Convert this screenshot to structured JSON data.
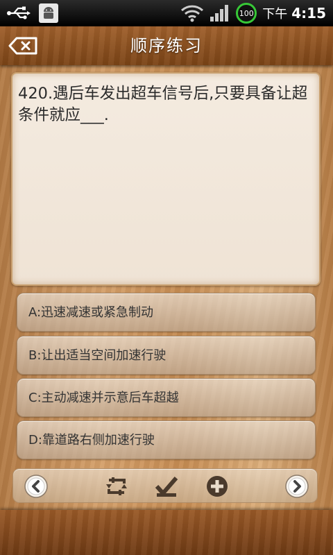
{
  "status_bar": {
    "battery_level": "100",
    "time_prefix": "下午",
    "time": "4:15"
  },
  "header": {
    "title": "顺序练习",
    "back_icon": "backspace-icon"
  },
  "question": {
    "text": "420.遇后车发出超车信号后,只要具备让超条件就应___."
  },
  "options": [
    {
      "label": "A:迅速减速或紧急制动"
    },
    {
      "label": "B:让出适当空间加速行驶"
    },
    {
      "label": "C:主动减速并示意后车超越"
    },
    {
      "label": "D:靠道路右侧加速行驶"
    }
  ],
  "toolbar": {
    "icons": [
      "chevron-left-icon",
      "switch-icon",
      "checklist-icon",
      "add-icon",
      "chevron-right-icon"
    ]
  },
  "colors": {
    "title_bar": "#8b4f22",
    "card_bg": "#f2e8dc",
    "option_bg": "#d6c8b8",
    "battery_ring": "#37c837"
  }
}
